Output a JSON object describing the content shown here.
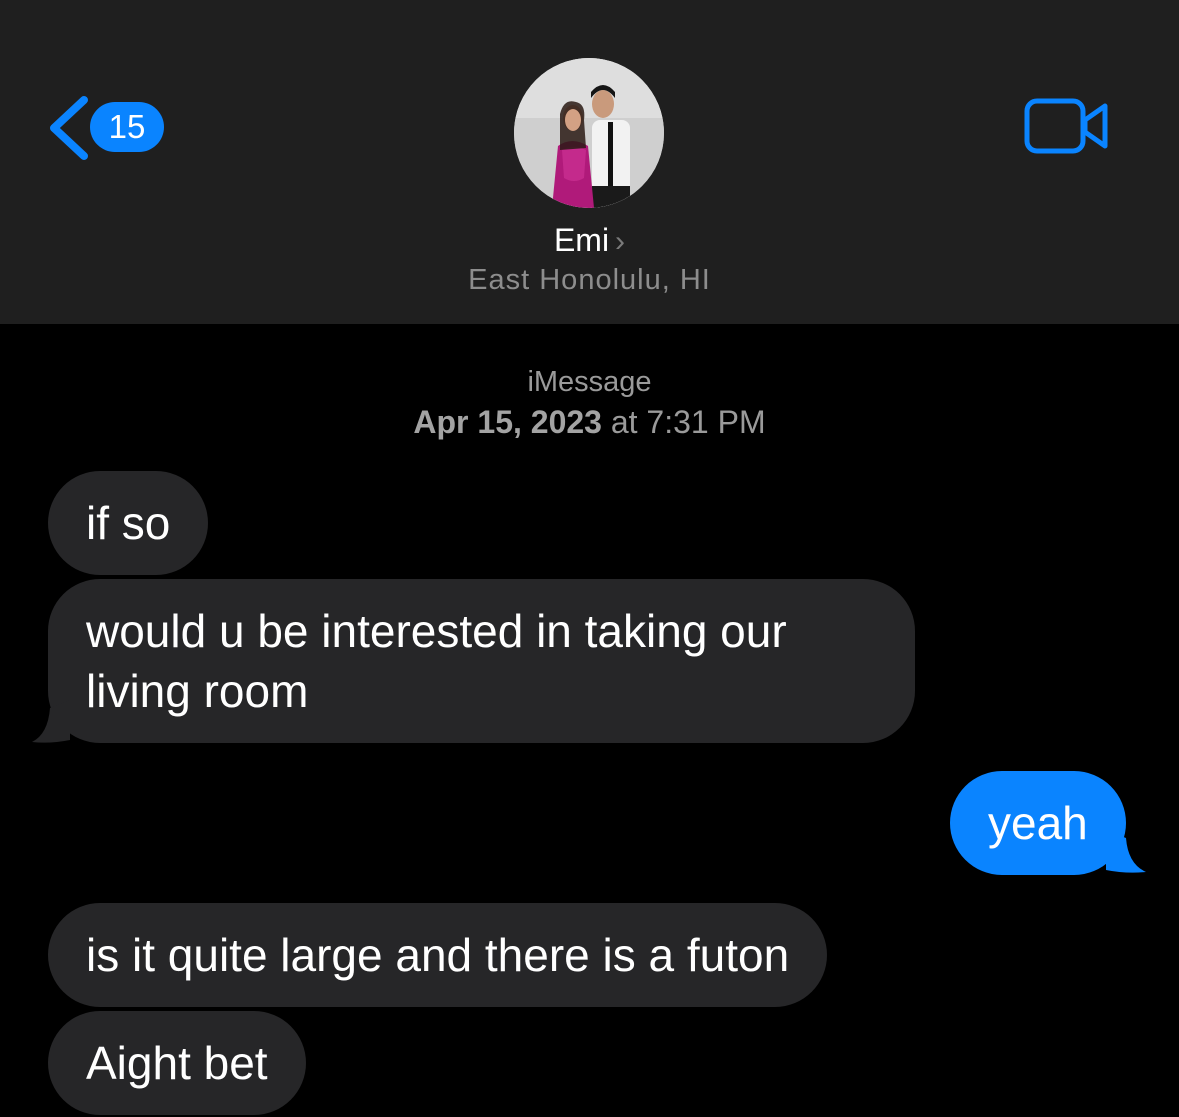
{
  "header": {
    "back_badge": "15",
    "contact_name": "Emi",
    "contact_location": "East Honolulu, HI"
  },
  "icons": {
    "back": "chevron-left-icon",
    "video": "video-camera-icon",
    "contact_chevron": "chevron-right-icon"
  },
  "thread": {
    "service": "iMessage",
    "date": "Apr 15, 2023",
    "time_prefix": "at",
    "time": "7:31 PM"
  },
  "messages": [
    {
      "sender": "other",
      "text": "if so"
    },
    {
      "sender": "other",
      "text_line1": "would u be interested in taking our",
      "text_line2": "living room"
    },
    {
      "sender": "me",
      "text": "yeah"
    },
    {
      "sender": "other",
      "text": "is it quite large and there is a futon"
    },
    {
      "sender": "other",
      "text": "Aight bet"
    }
  ],
  "colors": {
    "header_bg": "#1f1f1f",
    "background": "#000000",
    "received_bubble": "#262628",
    "sent_bubble": "#0a84ff",
    "accent": "#0a84ff"
  }
}
